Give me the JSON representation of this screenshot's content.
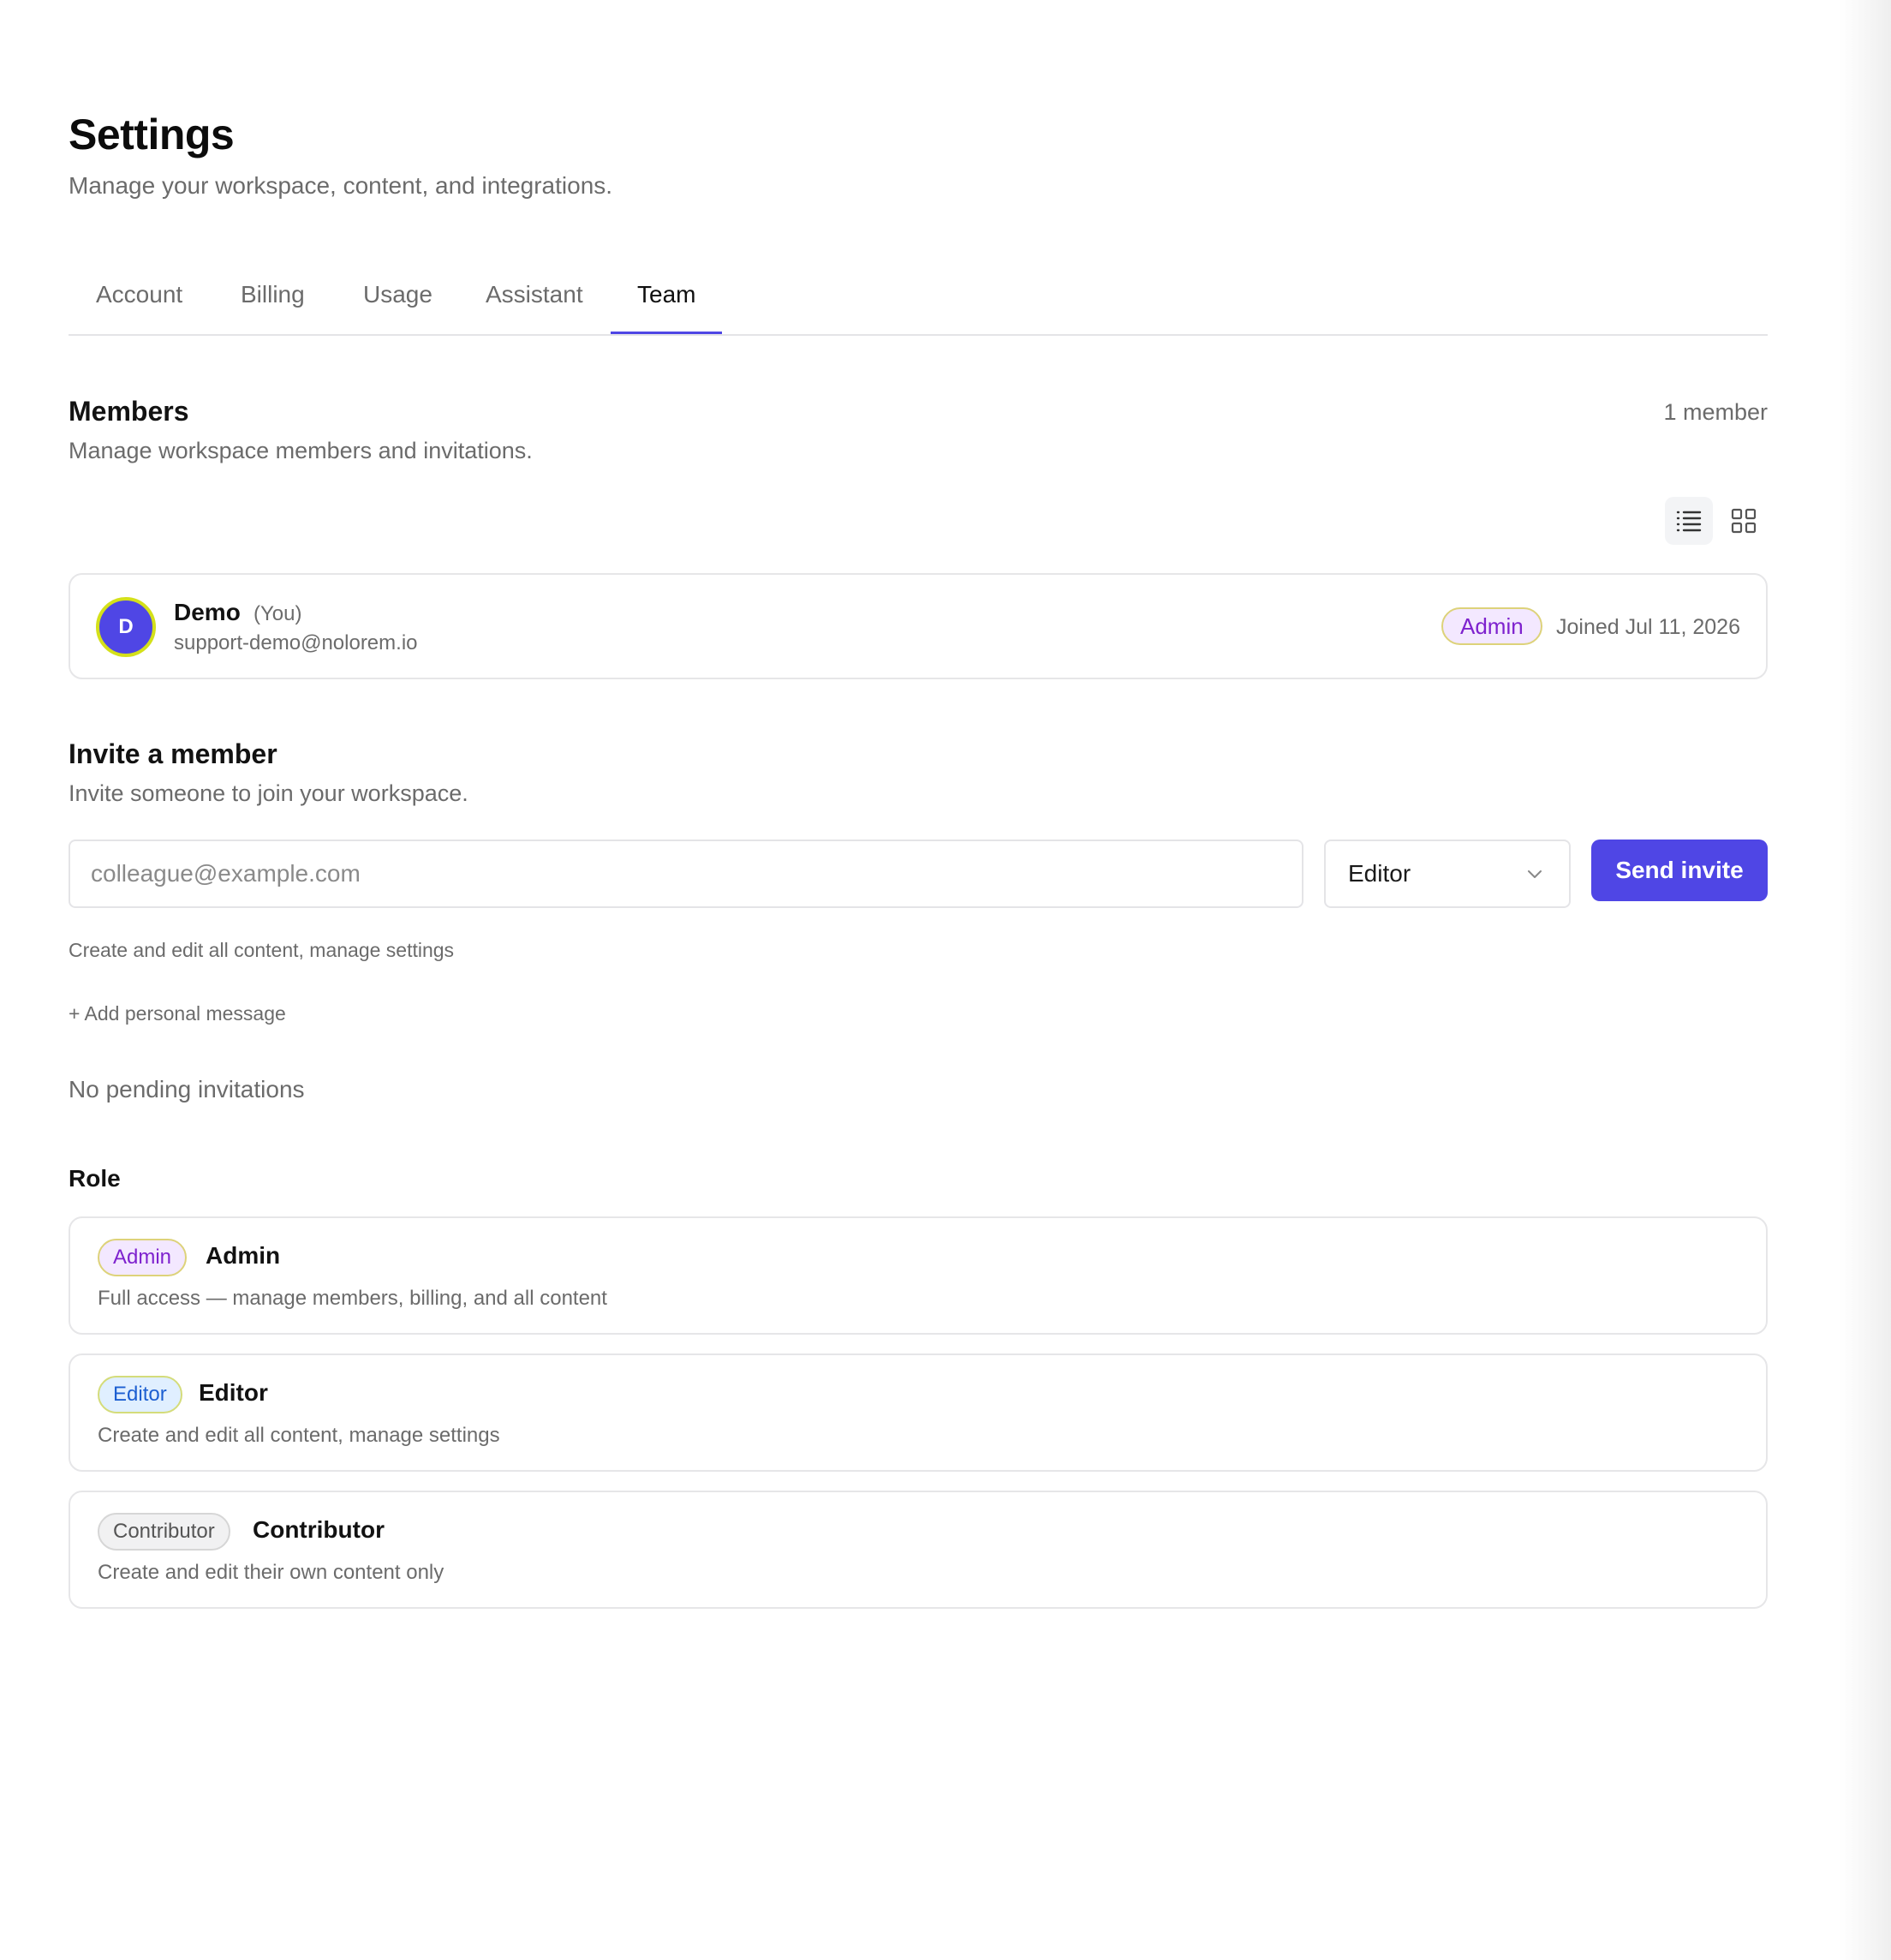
{
  "header": {
    "title": "Settings",
    "subtitle": "Manage your workspace, content, and integrations."
  },
  "tabs": [
    {
      "label": "Account",
      "active": false
    },
    {
      "label": "Billing",
      "active": false
    },
    {
      "label": "Usage",
      "active": false
    },
    {
      "label": "Assistant",
      "active": false
    },
    {
      "label": "Team",
      "active": true
    }
  ],
  "members": {
    "title": "Members",
    "subtitle": "Manage workspace members and invitations.",
    "count": "1 member",
    "view_toggle": {
      "active": "list",
      "icons": [
        "list-view-icon",
        "grid-view-icon"
      ]
    },
    "list": [
      {
        "avatar_initial": "D",
        "name": "Demo",
        "you_label": "(You)",
        "email": "support-demo@nolorem.io",
        "role_badge": "Admin",
        "joined": "Joined Jul 11, 2026"
      }
    ]
  },
  "invite": {
    "title": "Invite a member",
    "subtitle": "Invite someone to join your workspace.",
    "email_placeholder": "colleague@example.com",
    "email_value": "",
    "role_value": "Editor",
    "send_label": "Send invite",
    "role_description": "Create and edit all content, manage settings",
    "add_message_label": "+ Add personal message",
    "pending_text": "No pending invitations"
  },
  "roles": {
    "heading": "Role",
    "items": [
      {
        "badge": "Admin",
        "name": "Admin",
        "description": "Full access — manage members, billing, and all content"
      },
      {
        "badge": "Editor",
        "name": "Editor",
        "description": "Create and edit all content, manage settings"
      },
      {
        "badge": "Contributor",
        "name": "Contributor",
        "description": "Create and edit their own content only"
      }
    ]
  },
  "colors": {
    "accent": "#4f46e5",
    "admin_badge_bg": "#f3e8ff",
    "admin_badge_text": "#7e22ce",
    "editor_badge_bg": "#e0efff",
    "editor_badge_text": "#1d5fd1",
    "contributor_badge_bg": "#f1f1f2",
    "muted_text": "#6b6b6b",
    "border": "#e4e4e7"
  }
}
